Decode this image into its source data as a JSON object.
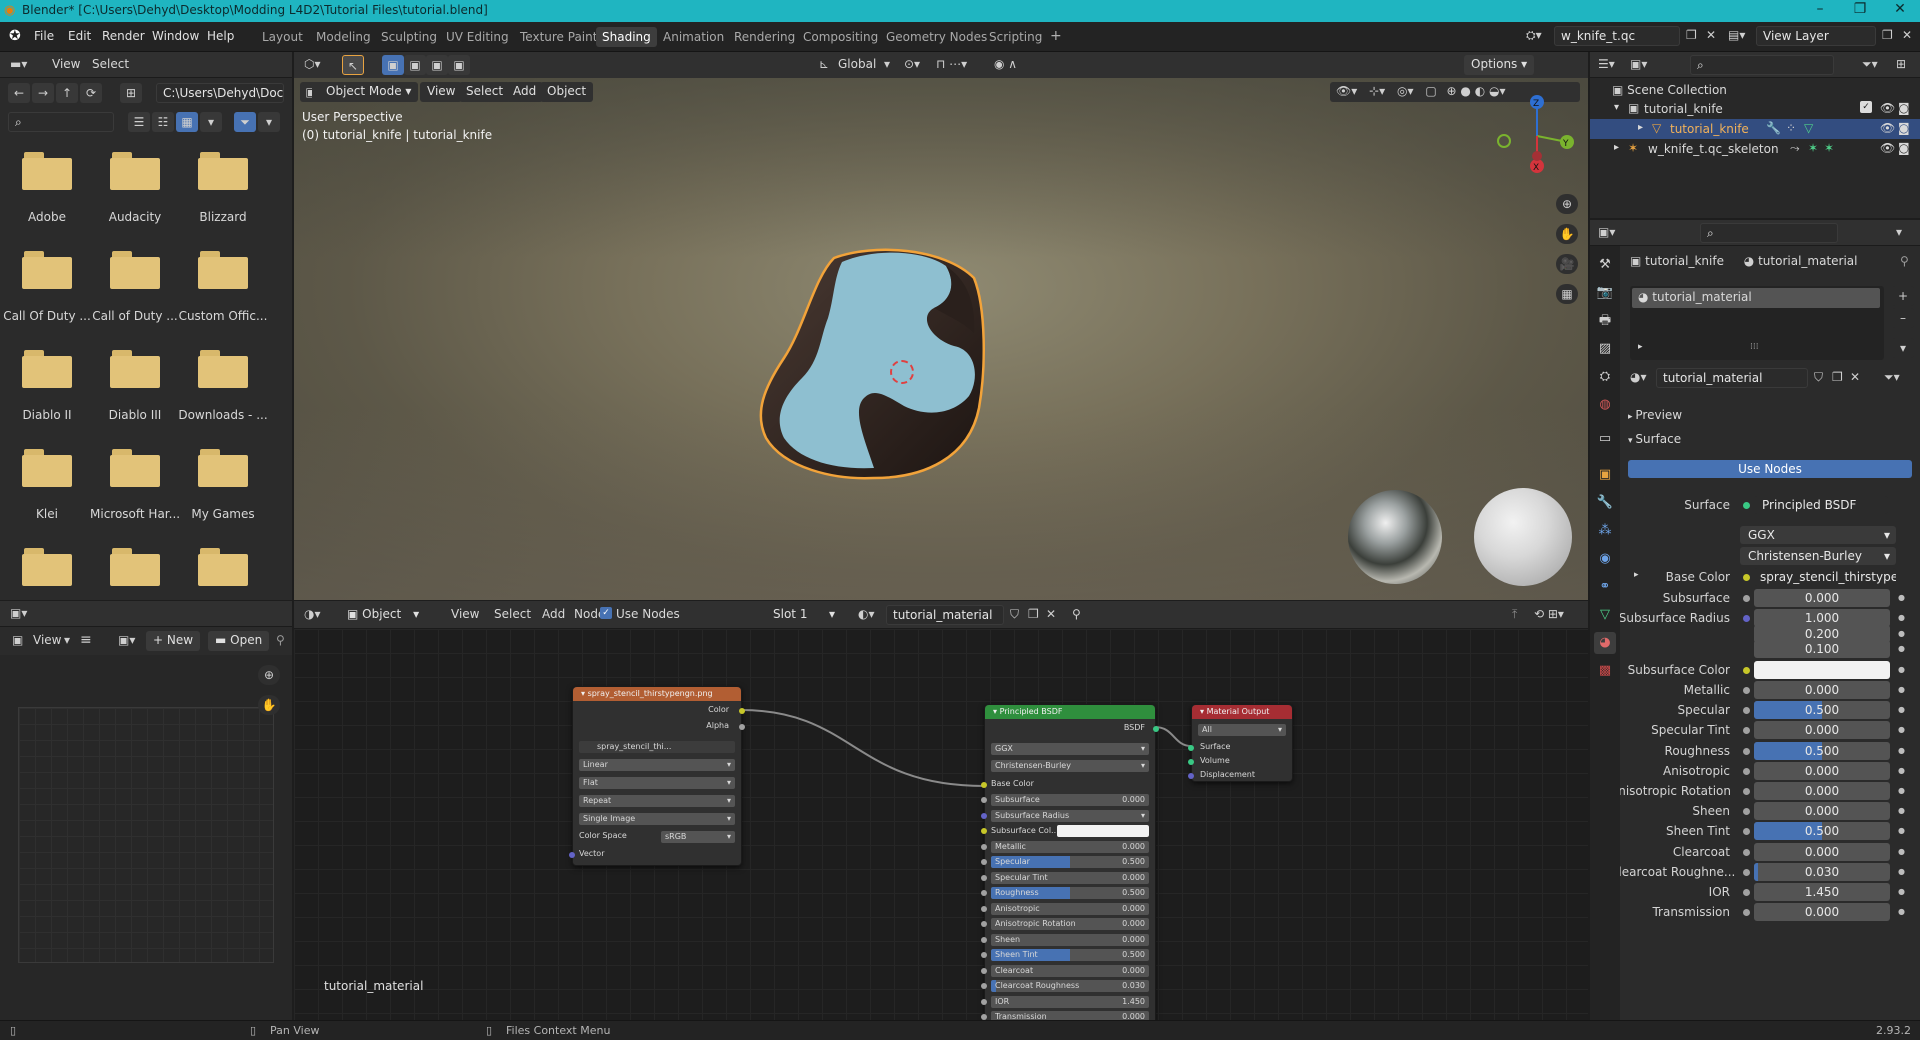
{
  "window": {
    "title": "Blender* [C:\\Users\\Dehyd\\Desktop\\Modding L4D2\\Tutorial Files\\tutorial.blend]",
    "version": "2.93.2"
  },
  "menu": [
    "File",
    "Edit",
    "Render",
    "Window",
    "Help"
  ],
  "workspaces": [
    "Layout",
    "Modeling",
    "Sculpting",
    "UV Editing",
    "Texture Paint",
    "Shading",
    "Animation",
    "Rendering",
    "Compositing",
    "Geometry Nodes",
    "Scripting"
  ],
  "active_workspace": "Shading",
  "top_right": {
    "scene": "w_knife_t.qc",
    "view_layer": "View Layer"
  },
  "file_browser": {
    "header": [
      "View",
      "Select"
    ],
    "path": "C:\\Users\\Dehyd\\Docu...",
    "folders": [
      "Adobe",
      "Audacity",
      "Blizzard",
      "Call Of Duty ...",
      "Call of Duty ...",
      "Custom Offic...",
      "Diablo II",
      "Diablo III",
      "Downloads - ...",
      "Klei",
      "Microsoft Har...",
      "My Games"
    ]
  },
  "viewport": {
    "mode": "Object Mode",
    "menus": [
      "View",
      "Select",
      "Add",
      "Object"
    ],
    "orientation": "Global",
    "options": "Options",
    "overlay_line1": "User Perspective",
    "overlay_line2": "(0) tutorial_knife | tutorial_knife",
    "axes": {
      "x": "X",
      "y": "Y",
      "z": "Z"
    }
  },
  "image_editor": {
    "view": "View",
    "new": "New",
    "open": "Open"
  },
  "node_editor": {
    "type": "Object",
    "menus": [
      "View",
      "Select",
      "Add",
      "Node"
    ],
    "use_nodes": "Use Nodes",
    "slot": "Slot 1",
    "material": "tutorial_material",
    "tree_label": "tutorial_material",
    "image_node": {
      "title": "spray_stencil_thirstypengn.png",
      "outputs": [
        "Color",
        "Alpha"
      ],
      "image": "spray_stencil_thi...",
      "interpolation": "Linear",
      "projection": "Flat",
      "extension": "Repeat",
      "source": "Single Image",
      "color_space_label": "Color Space",
      "color_space": "sRGB",
      "vector": "Vector"
    },
    "bsdf_node": {
      "title": "Principled BSDF",
      "output": "BSDF",
      "distribution": "GGX",
      "subsurface_method": "Christensen-Burley",
      "base_color": "Base Color",
      "fields": [
        {
          "label": "Subsurface",
          "value": "0.000",
          "fill": 0
        },
        {
          "label": "Subsurface Radius",
          "value": "",
          "fill": 0
        },
        {
          "label": "Subsurface Col...",
          "value": "",
          "fill": 0
        },
        {
          "label": "Metallic",
          "value": "0.000",
          "fill": 0
        },
        {
          "label": "Specular",
          "value": "0.500",
          "fill": 0.5
        },
        {
          "label": "Specular Tint",
          "value": "0.000",
          "fill": 0
        },
        {
          "label": "Roughness",
          "value": "0.500",
          "fill": 0.5
        },
        {
          "label": "Anisotropic",
          "value": "0.000",
          "fill": 0
        },
        {
          "label": "Anisotropic Rotation",
          "value": "0.000",
          "fill": 0
        },
        {
          "label": "Sheen",
          "value": "0.000",
          "fill": 0
        },
        {
          "label": "Sheen Tint",
          "value": "0.500",
          "fill": 0.5
        },
        {
          "label": "Clearcoat",
          "value": "0.000",
          "fill": 0
        },
        {
          "label": "Clearcoat Roughness",
          "value": "0.030",
          "fill": 0.03
        },
        {
          "label": "IOR",
          "value": "1.450",
          "fill": 0
        },
        {
          "label": "Transmission",
          "value": "0.000",
          "fill": 0
        }
      ]
    },
    "output_node": {
      "title": "Material Output",
      "target": "All",
      "inputs": [
        "Surface",
        "Volume",
        "Displacement"
      ]
    }
  },
  "outliner": {
    "scene_collection": "Scene Collection",
    "items": [
      "tutorial_knife",
      "tutorial_knife",
      "w_knife_t.qc_skeleton"
    ]
  },
  "properties": {
    "breadcrumb_object": "tutorial_knife",
    "breadcrumb_material": "tutorial_material",
    "slot_material": "tutorial_material",
    "material_name": "tutorial_material",
    "preview": "Preview",
    "surface_section": "Surface",
    "use_nodes": "Use Nodes",
    "surface_label": "Surface",
    "surface_value": "Principled BSDF",
    "distribution": "GGX",
    "subsurface_method": "Christensen-Burley",
    "base_color_label": "Base Color",
    "base_color_value": "spray_stencil_thirstypeng...",
    "rows": [
      {
        "label": "Subsurface",
        "value": "0.000",
        "fill": 0
      },
      {
        "label": "Subsurface Radius",
        "value": "1.000",
        "fill": 0
      },
      {
        "label": "",
        "value": "0.200",
        "fill": 0
      },
      {
        "label": "",
        "value": "0.100",
        "fill": 0
      },
      {
        "label": "Subsurface Color",
        "value": "",
        "fill": 0
      },
      {
        "label": "Metallic",
        "value": "0.000",
        "fill": 0
      },
      {
        "label": "Specular",
        "value": "0.500",
        "fill": 0.5
      },
      {
        "label": "Specular Tint",
        "value": "0.000",
        "fill": 0
      },
      {
        "label": "Roughness",
        "value": "0.500",
        "fill": 0.5
      },
      {
        "label": "Anisotropic",
        "value": "0.000",
        "fill": 0
      },
      {
        "label": "Anisotropic Rotation",
        "value": "0.000",
        "fill": 0
      },
      {
        "label": "Sheen",
        "value": "0.000",
        "fill": 0
      },
      {
        "label": "Sheen Tint",
        "value": "0.500",
        "fill": 0.5
      },
      {
        "label": "Clearcoat",
        "value": "0.000",
        "fill": 0
      },
      {
        "label": "Clearcoat Roughne...",
        "value": "0.030",
        "fill": 0.03
      },
      {
        "label": "IOR",
        "value": "1.450",
        "fill": 0
      },
      {
        "label": "Transmission",
        "value": "0.000",
        "fill": 0
      }
    ]
  },
  "statusbar": {
    "pan": "Pan View",
    "context": "Files Context Menu"
  },
  "colors": {
    "accent": "#4772b3",
    "titlebar": "#1fb5c1",
    "image_node": "#b25e33",
    "shader_node": "#2f8f3d",
    "output_node": "#a62d33",
    "folder": "#e2c379"
  }
}
